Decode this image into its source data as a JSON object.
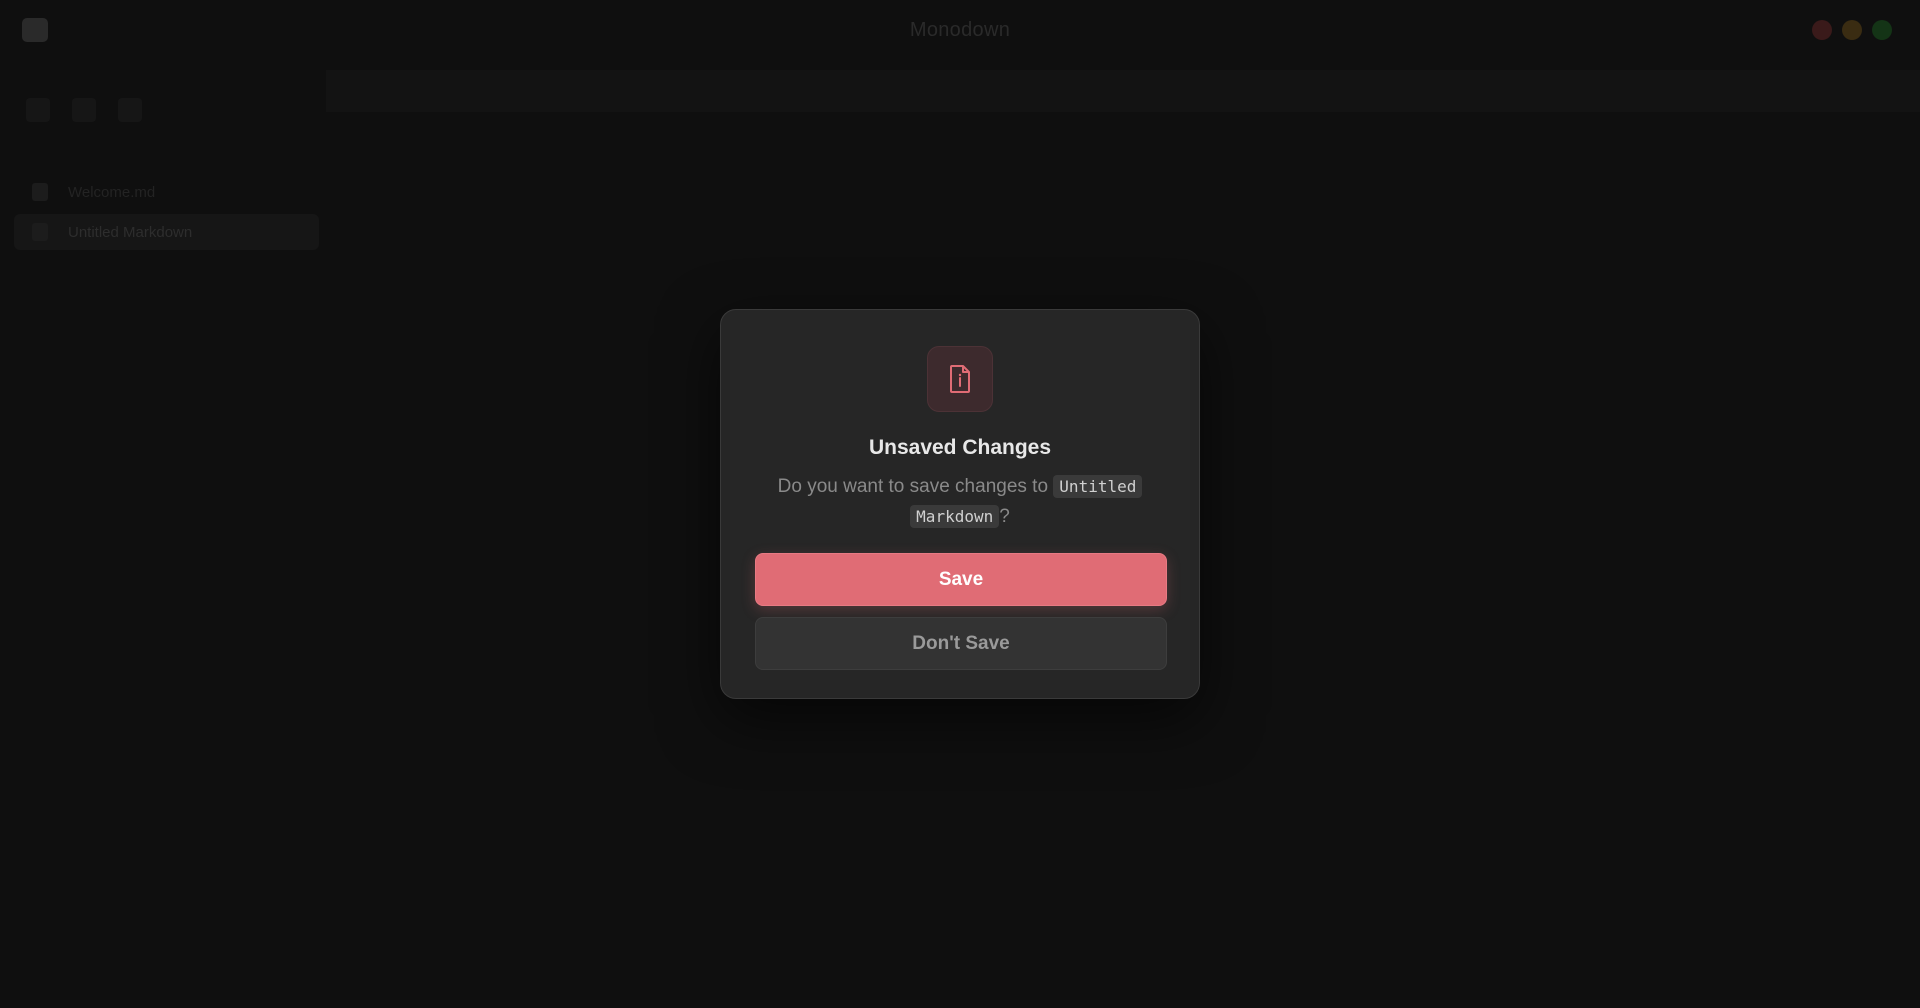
{
  "app": {
    "title": "Monodown"
  },
  "window_controls": {
    "close_color": "#ff5f57",
    "minimize_color": "#febc2e",
    "maximize_color": "#28c840"
  },
  "sidebar": {
    "items": [
      {
        "label": "Welcome.md",
        "icon": "file-icon",
        "active": false
      },
      {
        "label": "Untitled Markdown",
        "icon": "file-icon",
        "active": true
      }
    ]
  },
  "dialog": {
    "icon": "file-info-icon",
    "title": "Unsaved Changes",
    "message_prefix": "Do you want to save changes to",
    "file_name_line1": "Untitled",
    "file_name_line2": "Markdown",
    "message_suffix": "?",
    "save_label": "Save",
    "dont_save_label": "Don't Save",
    "accent_color": "#e06c75"
  }
}
